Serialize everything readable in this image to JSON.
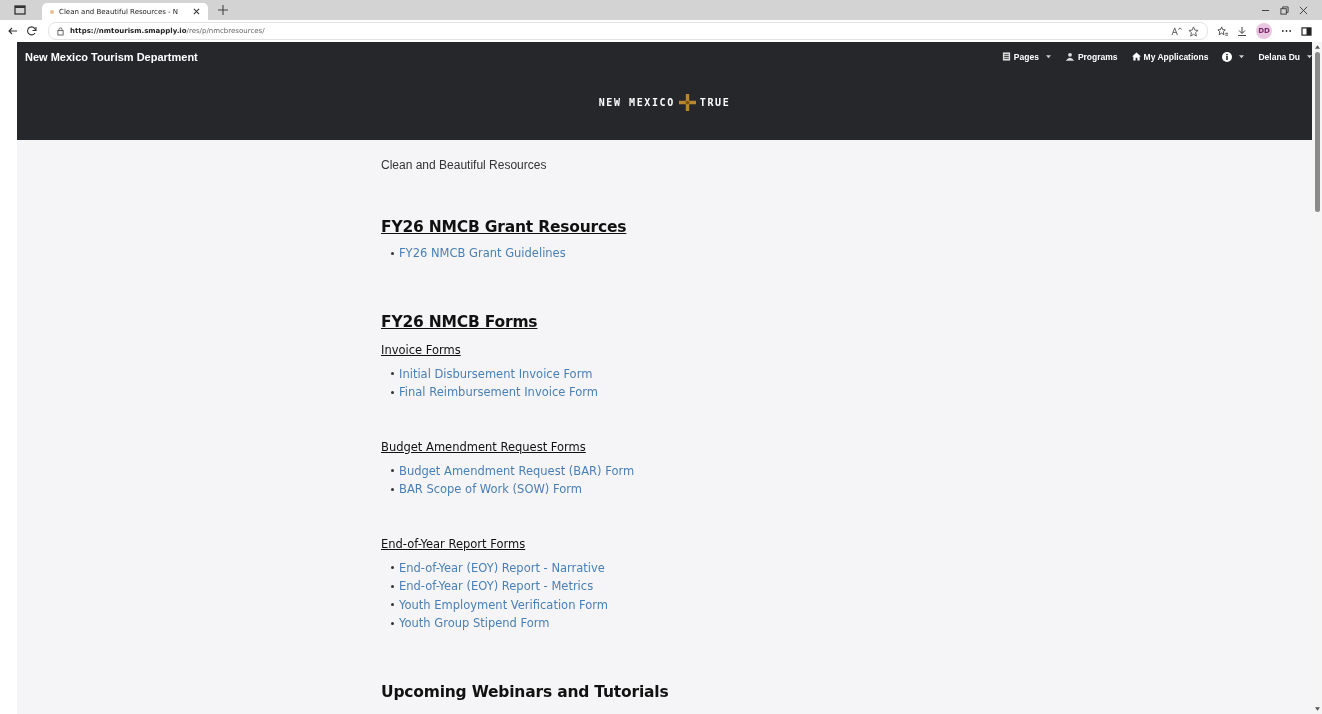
{
  "browser": {
    "tab_title": "Clean and Beautiful Resources - N",
    "url_host": "https://nmtourism.smapply.io",
    "url_path": "/res/p/nmcbresources/",
    "profile": "DD"
  },
  "navbar": {
    "brand": "New Mexico Tourism Department",
    "items": [
      {
        "label": "Pages",
        "kind": "pages",
        "dropdown": true
      },
      {
        "label": "Programs",
        "kind": "programs",
        "dropdown": false
      },
      {
        "label": "My Applications",
        "kind": "home",
        "dropdown": false
      },
      {
        "kind": "info",
        "dropdown": true
      },
      {
        "label": "Delana Du",
        "kind": "user",
        "dropdown": true
      }
    ]
  },
  "logo": {
    "left": "NEW MEXICO",
    "right": "TRUE"
  },
  "page_title": "Clean and Beautiful Resources",
  "sections": [
    {
      "heading": "FY26 NMCB Grant Resources",
      "groups": [
        {
          "links": [
            "FY26 NMCB Grant Guidelines"
          ]
        }
      ]
    },
    {
      "heading": "FY26 NMCB Forms",
      "groups": [
        {
          "subheading": "Invoice Forms",
          "links": [
            "Initial Disbursement Invoice Form",
            "Final Reimbursement Invoice Form"
          ]
        },
        {
          "subheading": "Budget Amendment Request Forms",
          "links": [
            "Budget Amendment Request (BAR) Form",
            "BAR Scope of Work (SOW) Form"
          ]
        },
        {
          "subheading": "End-of-Year Report Forms",
          "links": [
            "End-of-Year (EOY) Report - Narrative",
            "End-of-Year (EOY) Report - Metrics",
            "Youth Employment Verification Form",
            "Youth Group Stipend Form"
          ]
        }
      ]
    },
    {
      "heading": "Upcoming Webinars and Tutorials",
      "underlined": false
    }
  ]
}
